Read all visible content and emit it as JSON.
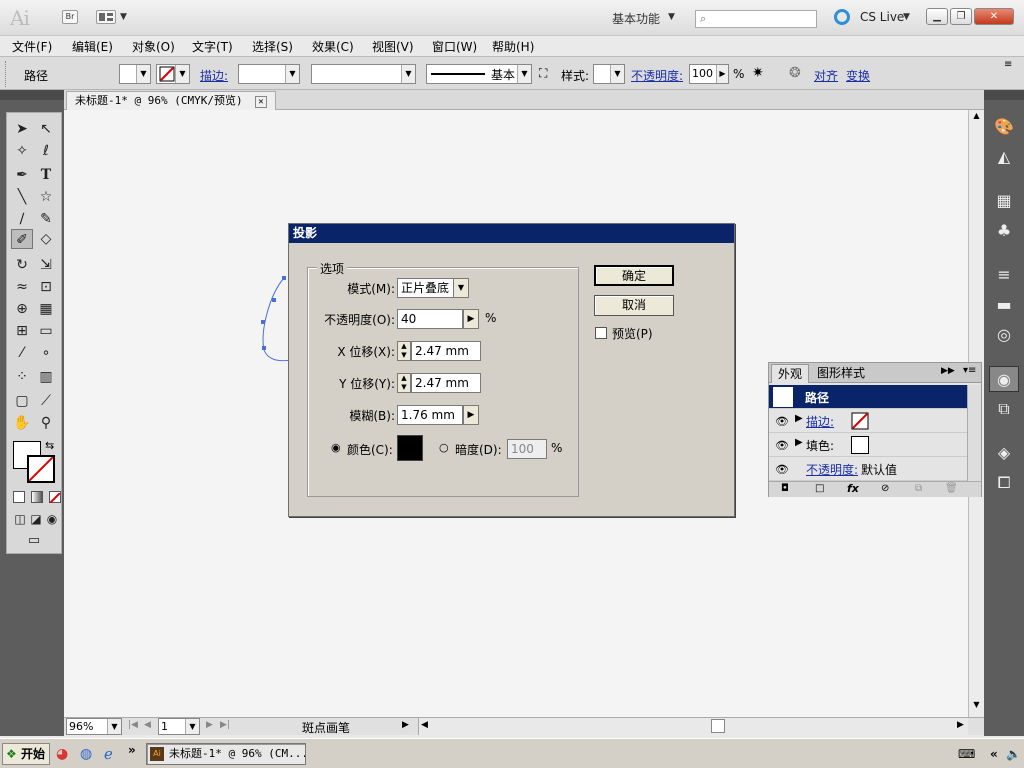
{
  "app": {
    "logo": "Ai",
    "bridge_label": "Br",
    "workspace": "基本功能",
    "cs_live": "CS Live"
  },
  "menu": [
    "文件(F)",
    "编辑(E)",
    "对象(O)",
    "文字(T)",
    "选择(S)",
    "效果(C)",
    "视图(V)",
    "窗口(W)",
    "帮助(H)"
  ],
  "control": {
    "object_label": "路径",
    "stroke_link": "描边:",
    "stroke_profile": "基本",
    "style_label": "样式:",
    "opacity_link": "不透明度:",
    "opacity_value": "100",
    "opacity_unit": "%",
    "align_link": "对齐",
    "transform_link": "变换"
  },
  "document_tab": "未标题-1* @ 96% (CMYK/预览)",
  "dialog": {
    "title": "投影",
    "group_label": "选项",
    "mode_label": "模式(M):",
    "mode_value": "正片叠底",
    "opacity_label": "不透明度(O):",
    "opacity_value": "40",
    "opacity_unit": "%",
    "x_offset_label": "X 位移(X):",
    "x_offset_value": "2.47 mm",
    "y_offset_label": "Y 位移(Y):",
    "y_offset_value": "2.47 mm",
    "blur_label": "模糊(B):",
    "blur_value": "1.76 mm",
    "color_label": "颜色(C):",
    "darkness_label": "暗度(D):",
    "darkness_value": "100",
    "darkness_unit": "%",
    "ok": "确定",
    "cancel": "取消",
    "preview": "预览(P)",
    "color_selected": true,
    "swatch_color": "#000000"
  },
  "appearance_panel": {
    "tabs": [
      "外观",
      "图形样式"
    ],
    "header": "路径",
    "stroke_label": "描边:",
    "fill_label": "填色:",
    "opacity_label": "不透明度:",
    "opacity_value": "默认值"
  },
  "status": {
    "zoom": "96%",
    "page": "1",
    "tool": "斑点画笔"
  },
  "taskbar": {
    "start": "开始",
    "task": "未标题-1* @ 96% (CM..."
  },
  "colors": {
    "dialog_title_bg": "#0a246a",
    "link": "#1a2fa6",
    "path_stroke": "#4a6fd8"
  }
}
